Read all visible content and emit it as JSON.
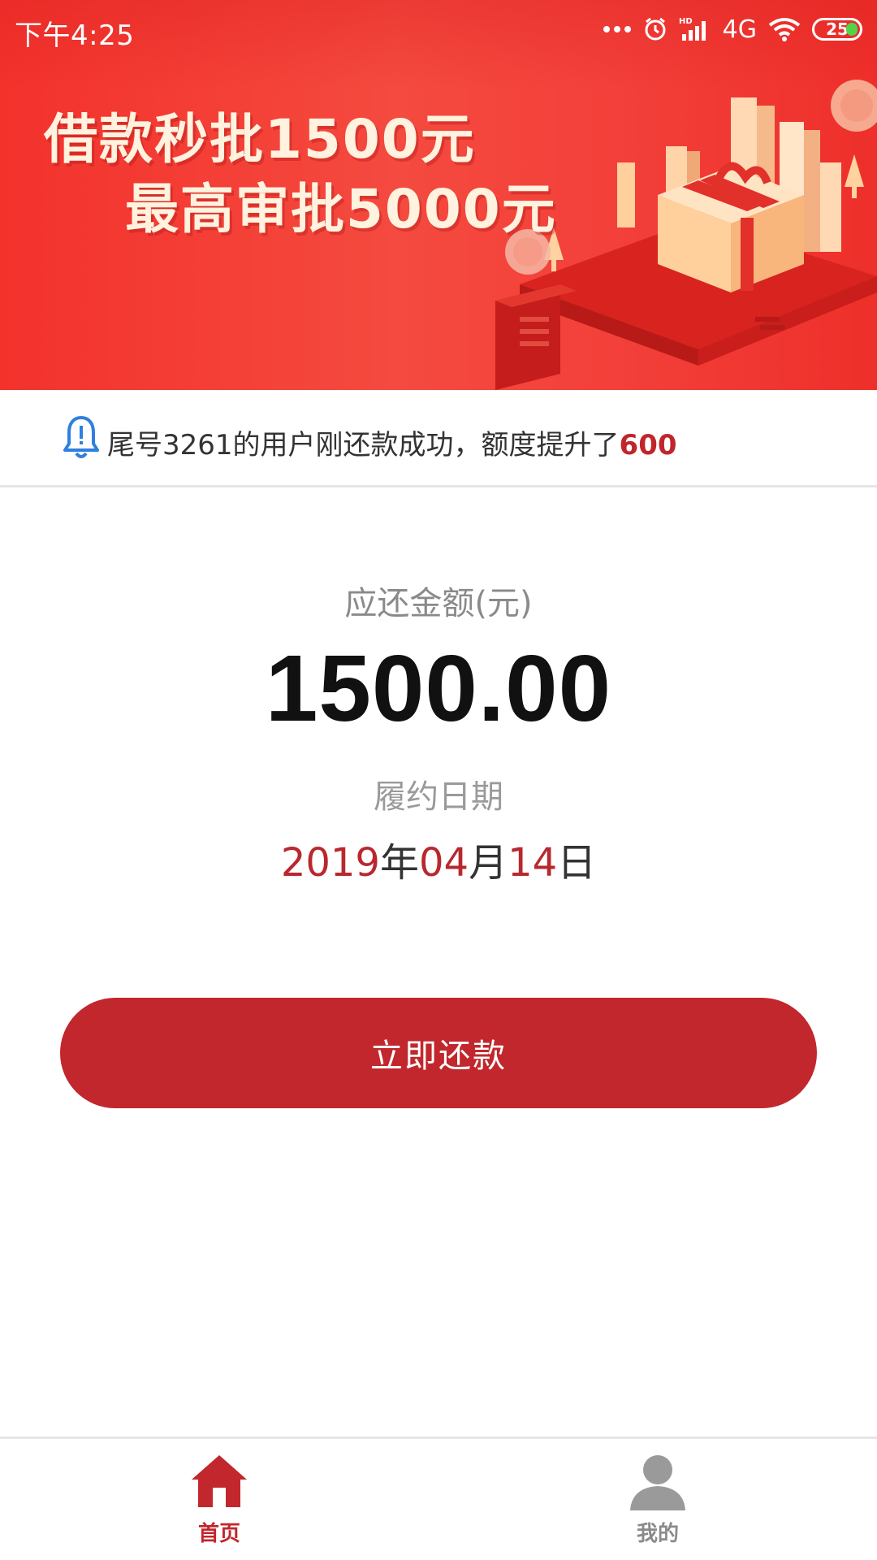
{
  "status_bar": {
    "time": "下午4:25",
    "network": "4G",
    "signal_label": "HD",
    "battery": "25"
  },
  "banner": {
    "line1": "借款秒批1500元",
    "line2": "最高审批5000元"
  },
  "notice": {
    "text": "尾号3261的用户刚还款成功，额度提升了",
    "highlight": "600"
  },
  "repayment": {
    "amount_label": "应还金额(元)",
    "amount": "1500.00",
    "date_label": "履约日期",
    "date": {
      "year": "2019",
      "year_unit": "年",
      "month": "04",
      "month_unit": "月",
      "day": "14",
      "day_unit": "日"
    },
    "button_label": "立即还款"
  },
  "bottom_nav": {
    "items": [
      {
        "label": "首页",
        "icon": "home-icon",
        "active": true
      },
      {
        "label": "我的",
        "icon": "user-icon",
        "active": false
      }
    ]
  },
  "colors": {
    "brand_red": "#c1272d",
    "banner_red": "#f3322c",
    "highlight_red": "#b8282e"
  }
}
